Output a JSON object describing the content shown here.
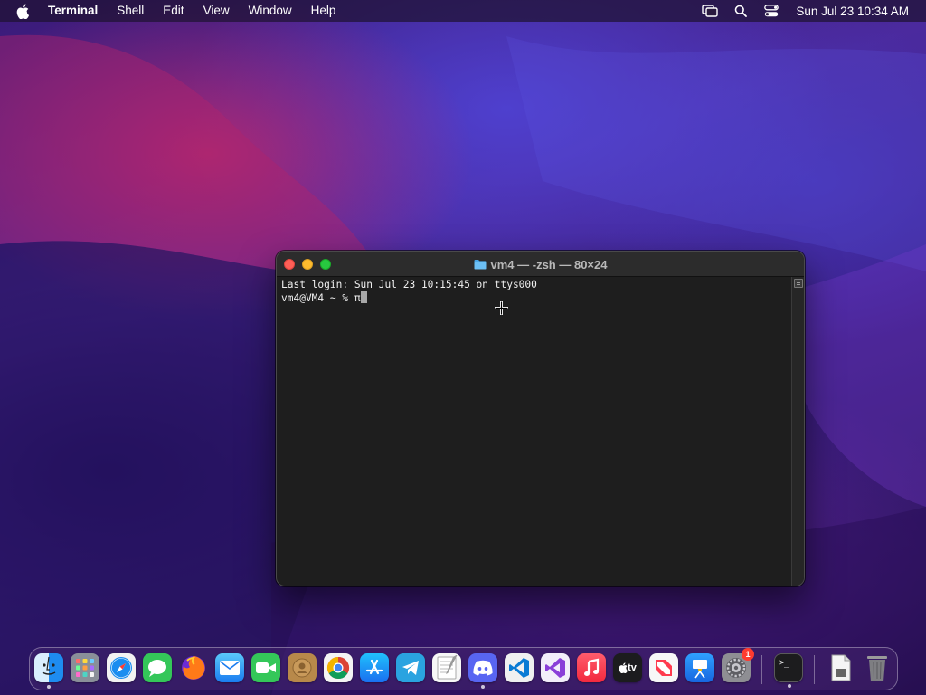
{
  "menubar": {
    "app_name": "Terminal",
    "menus": [
      "Shell",
      "Edit",
      "View",
      "Window",
      "Help"
    ],
    "status_icons": [
      "screen-mirroring-icon",
      "search-icon",
      "control-center-icon"
    ],
    "clock": "Sun Jul 23  10:34 AM"
  },
  "terminal": {
    "title": "vm4 — -zsh — 80×24",
    "lines": [
      "Last login: Sun Jul 23 10:15:45 on ttys000",
      "vm4@VM4 ~ % π"
    ]
  },
  "dock": {
    "apps": [
      {
        "name": "finder",
        "icon": "finder-icon",
        "running": true
      },
      {
        "name": "launchpad",
        "icon": "launchpad-icon",
        "running": false
      },
      {
        "name": "safari",
        "icon": "safari-icon",
        "running": false
      },
      {
        "name": "messages",
        "icon": "messages-icon",
        "running": false
      },
      {
        "name": "firefox",
        "icon": "firefox-icon",
        "running": false
      },
      {
        "name": "mail",
        "icon": "mail-icon",
        "running": false
      },
      {
        "name": "facetime",
        "icon": "facetime-icon",
        "running": false
      },
      {
        "name": "contacts",
        "icon": "contacts-icon",
        "running": false
      },
      {
        "name": "chrome",
        "icon": "chrome-icon",
        "running": false
      },
      {
        "name": "app-store",
        "icon": "app-store-icon",
        "running": false
      },
      {
        "name": "telegram",
        "icon": "telegram-icon",
        "running": false
      },
      {
        "name": "textedit",
        "icon": "textedit-icon",
        "running": false
      },
      {
        "name": "discord",
        "icon": "discord-icon",
        "running": true
      },
      {
        "name": "vscode",
        "icon": "vscode-icon",
        "running": false
      },
      {
        "name": "visual-studio",
        "icon": "visual-studio-icon",
        "running": false
      },
      {
        "name": "music",
        "icon": "music-icon",
        "running": false
      },
      {
        "name": "apple-tv",
        "icon": "apple-tv-icon",
        "running": false,
        "label": "tv"
      },
      {
        "name": "news",
        "icon": "news-icon",
        "running": false
      },
      {
        "name": "keynote",
        "icon": "keynote-icon",
        "running": false
      },
      {
        "name": "system-preferences",
        "icon": "gear-icon",
        "running": false,
        "badge": "1"
      },
      {
        "name": "terminal",
        "icon": "terminal-icon",
        "running": true,
        "label": ">_"
      },
      {
        "name": "document",
        "icon": "document-icon",
        "running": false
      },
      {
        "name": "trash",
        "icon": "trash-icon",
        "running": false
      }
    ]
  },
  "colors": {
    "close": "#fe5f57",
    "minimize": "#febc2e",
    "zoom": "#28c840",
    "terminal_bg": "#1e1e1e"
  }
}
